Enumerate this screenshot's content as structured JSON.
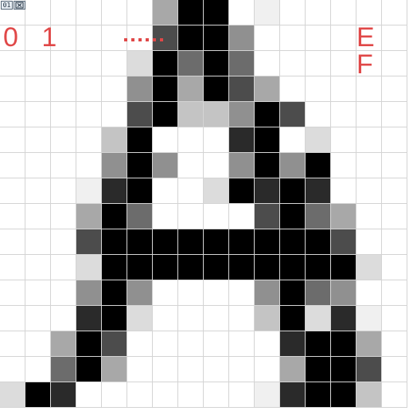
{
  "toolbar": {
    "code_label": "01",
    "close_icon": "close-icon"
  },
  "labels": {
    "left": "0 1",
    "right": "E F",
    "dots": "......"
  },
  "colors": {
    "label_red": "#e04848",
    "grid_line": "#d4d4d4"
  },
  "glyph": {
    "columns": 16,
    "rows": 16,
    "palette": {
      "0": "#ffffff",
      "1": "#f0f0f0",
      "2": "#dcdcdc",
      "3": "#c4c4c4",
      "4": "#a8a8a8",
      "5": "#909090",
      "6": "#6c6c6c",
      "7": "#4c4c4c",
      "8": "#2a2a2a",
      "9": "#000000"
    },
    "levels": [
      "0000004990100000",
      "0000007995000000",
      "0000029696000000",
      "0000059497400000",
      "0000079335970000",
      "0000390008902000",
      "0000595005959000",
      "0001890029898000",
      "0004960000796400",
      "0007999999999700",
      "0002999999999920",
      "0005950000596500",
      "0008920000392810",
      "0049700000089940",
      "0069400000049970",
      "2980000000189930"
    ]
  }
}
